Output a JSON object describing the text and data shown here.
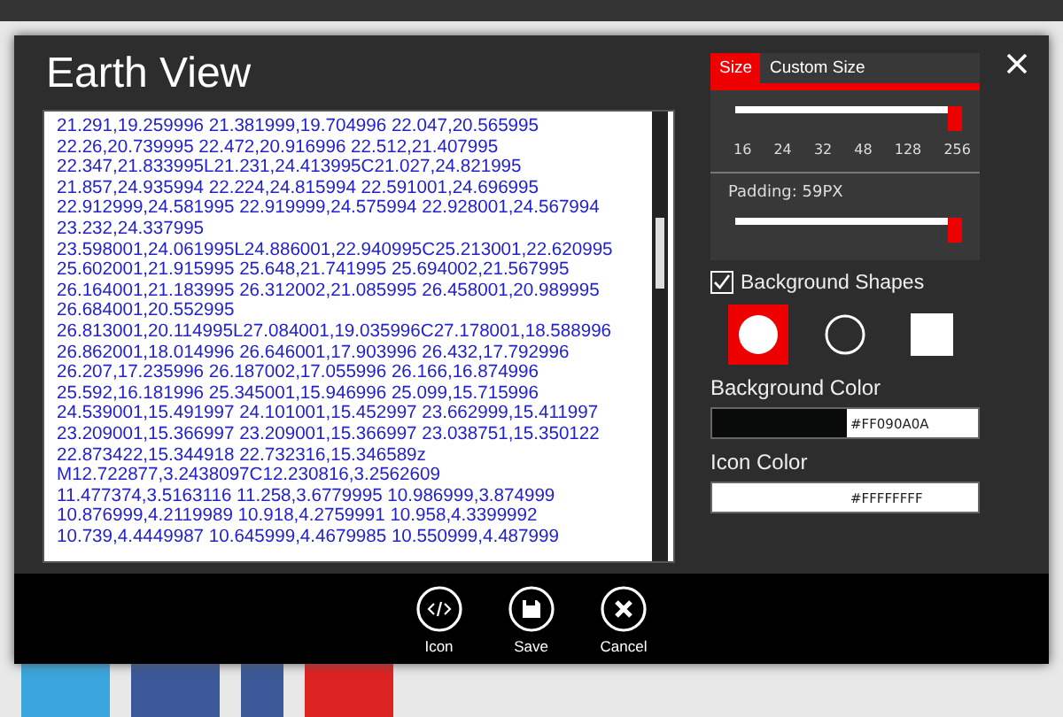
{
  "dialog": {
    "title": "Earth View",
    "code_lines": [
      "21.291,19.259996 21.381999,19.704996 22.047,20.565995",
      "22.26,20.739995 22.472,20.916996 22.512,21.407995",
      "22.347,21.833995L21.231,24.413995C21.027,24.821995",
      "21.857,24.935994 22.224,24.815994 22.591001,24.696995",
      "22.912999,24.581995 22.919999,24.575994 22.928001,24.567994",
      "23.232,24.337995",
      "23.598001,24.061995L24.886001,22.940995C25.213001,22.620995",
      "25.602001,21.915995 25.648,21.741995 25.694002,21.567995",
      "26.164001,21.183995 26.312002,21.085995 26.458001,20.989995",
      "26.684001,20.552995",
      "26.813001,20.114995L27.084001,19.035996C27.178001,18.588996",
      "26.862001,18.014996 26.646001,17.903996 26.432,17.792996",
      "26.207,17.235996 26.187002,17.055996 26.166,16.874996",
      "25.592,16.181996 25.345001,15.946996 25.099,15.715996",
      "24.539001,15.491997 24.101001,15.452997 23.662999,15.411997",
      "23.209001,15.366997 23.209001,15.366997 23.038751,15.350122",
      "22.873422,15.344918 22.732316,15.346589z",
      "M12.722877,3.2438097C12.230816,3.2562609",
      "11.477374,3.5163116 11.258,3.6779995 10.986999,3.874999",
      "10.876999,4.2119989 10.918,4.2759991 10.958,4.3399992",
      "10.739,4.4449987 10.645999,4.4679985 10.550999,4.487999"
    ],
    "tabs": [
      {
        "label": "Size",
        "selected": true
      },
      {
        "label": "Custom Size",
        "selected": false
      }
    ],
    "size_slider": {
      "level": 1,
      "ticks": [
        "16",
        "24",
        "32",
        "48",
        "128",
        "256"
      ]
    },
    "padding": {
      "label": "Padding: 59PX",
      "level": 1
    },
    "background_shapes": {
      "label": "Background Shapes",
      "checked": true,
      "shapes": [
        {
          "kind": "filled-circle",
          "selected": true
        },
        {
          "kind": "ring",
          "selected": false
        },
        {
          "kind": "square",
          "selected": false
        }
      ]
    },
    "background_color": {
      "label": "Background Color",
      "value": "#FF090A0A",
      "color": "#090a0a"
    },
    "icon_color": {
      "label": "Icon Color",
      "value": "#FFFFFFFF",
      "color": "#ffffff"
    },
    "buttons": [
      {
        "kind": "code",
        "label": "Icon"
      },
      {
        "kind": "save",
        "label": "Save"
      },
      {
        "kind": "cancel",
        "label": "Cancel"
      }
    ]
  }
}
